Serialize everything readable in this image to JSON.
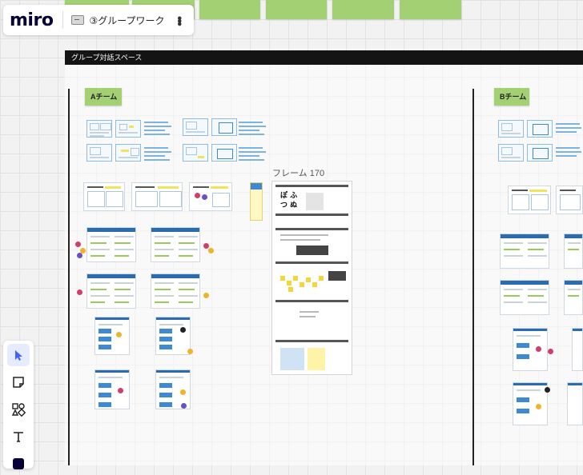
{
  "app": {
    "logo": "miro",
    "board_name": "③グループワーク"
  },
  "section": {
    "title": "グループ対話スペース"
  },
  "teams": [
    {
      "label": "Aチーム"
    },
    {
      "label": "Bチーム"
    }
  ],
  "frame": {
    "title": "フレーム 170",
    "glyphs": "ぽ ふ つ ぬ"
  },
  "toolbar": {
    "tools": [
      {
        "name": "select",
        "icon": "cursor-icon",
        "active": true
      },
      {
        "name": "sticky-note",
        "icon": "sticky-note-icon",
        "active": false
      },
      {
        "name": "shapes",
        "icon": "shapes-icon",
        "active": false
      },
      {
        "name": "text",
        "icon": "text-icon",
        "active": false
      }
    ]
  },
  "colors": {
    "accent": "#4262ff",
    "sticky": "#a3d073",
    "section": "#141414"
  }
}
